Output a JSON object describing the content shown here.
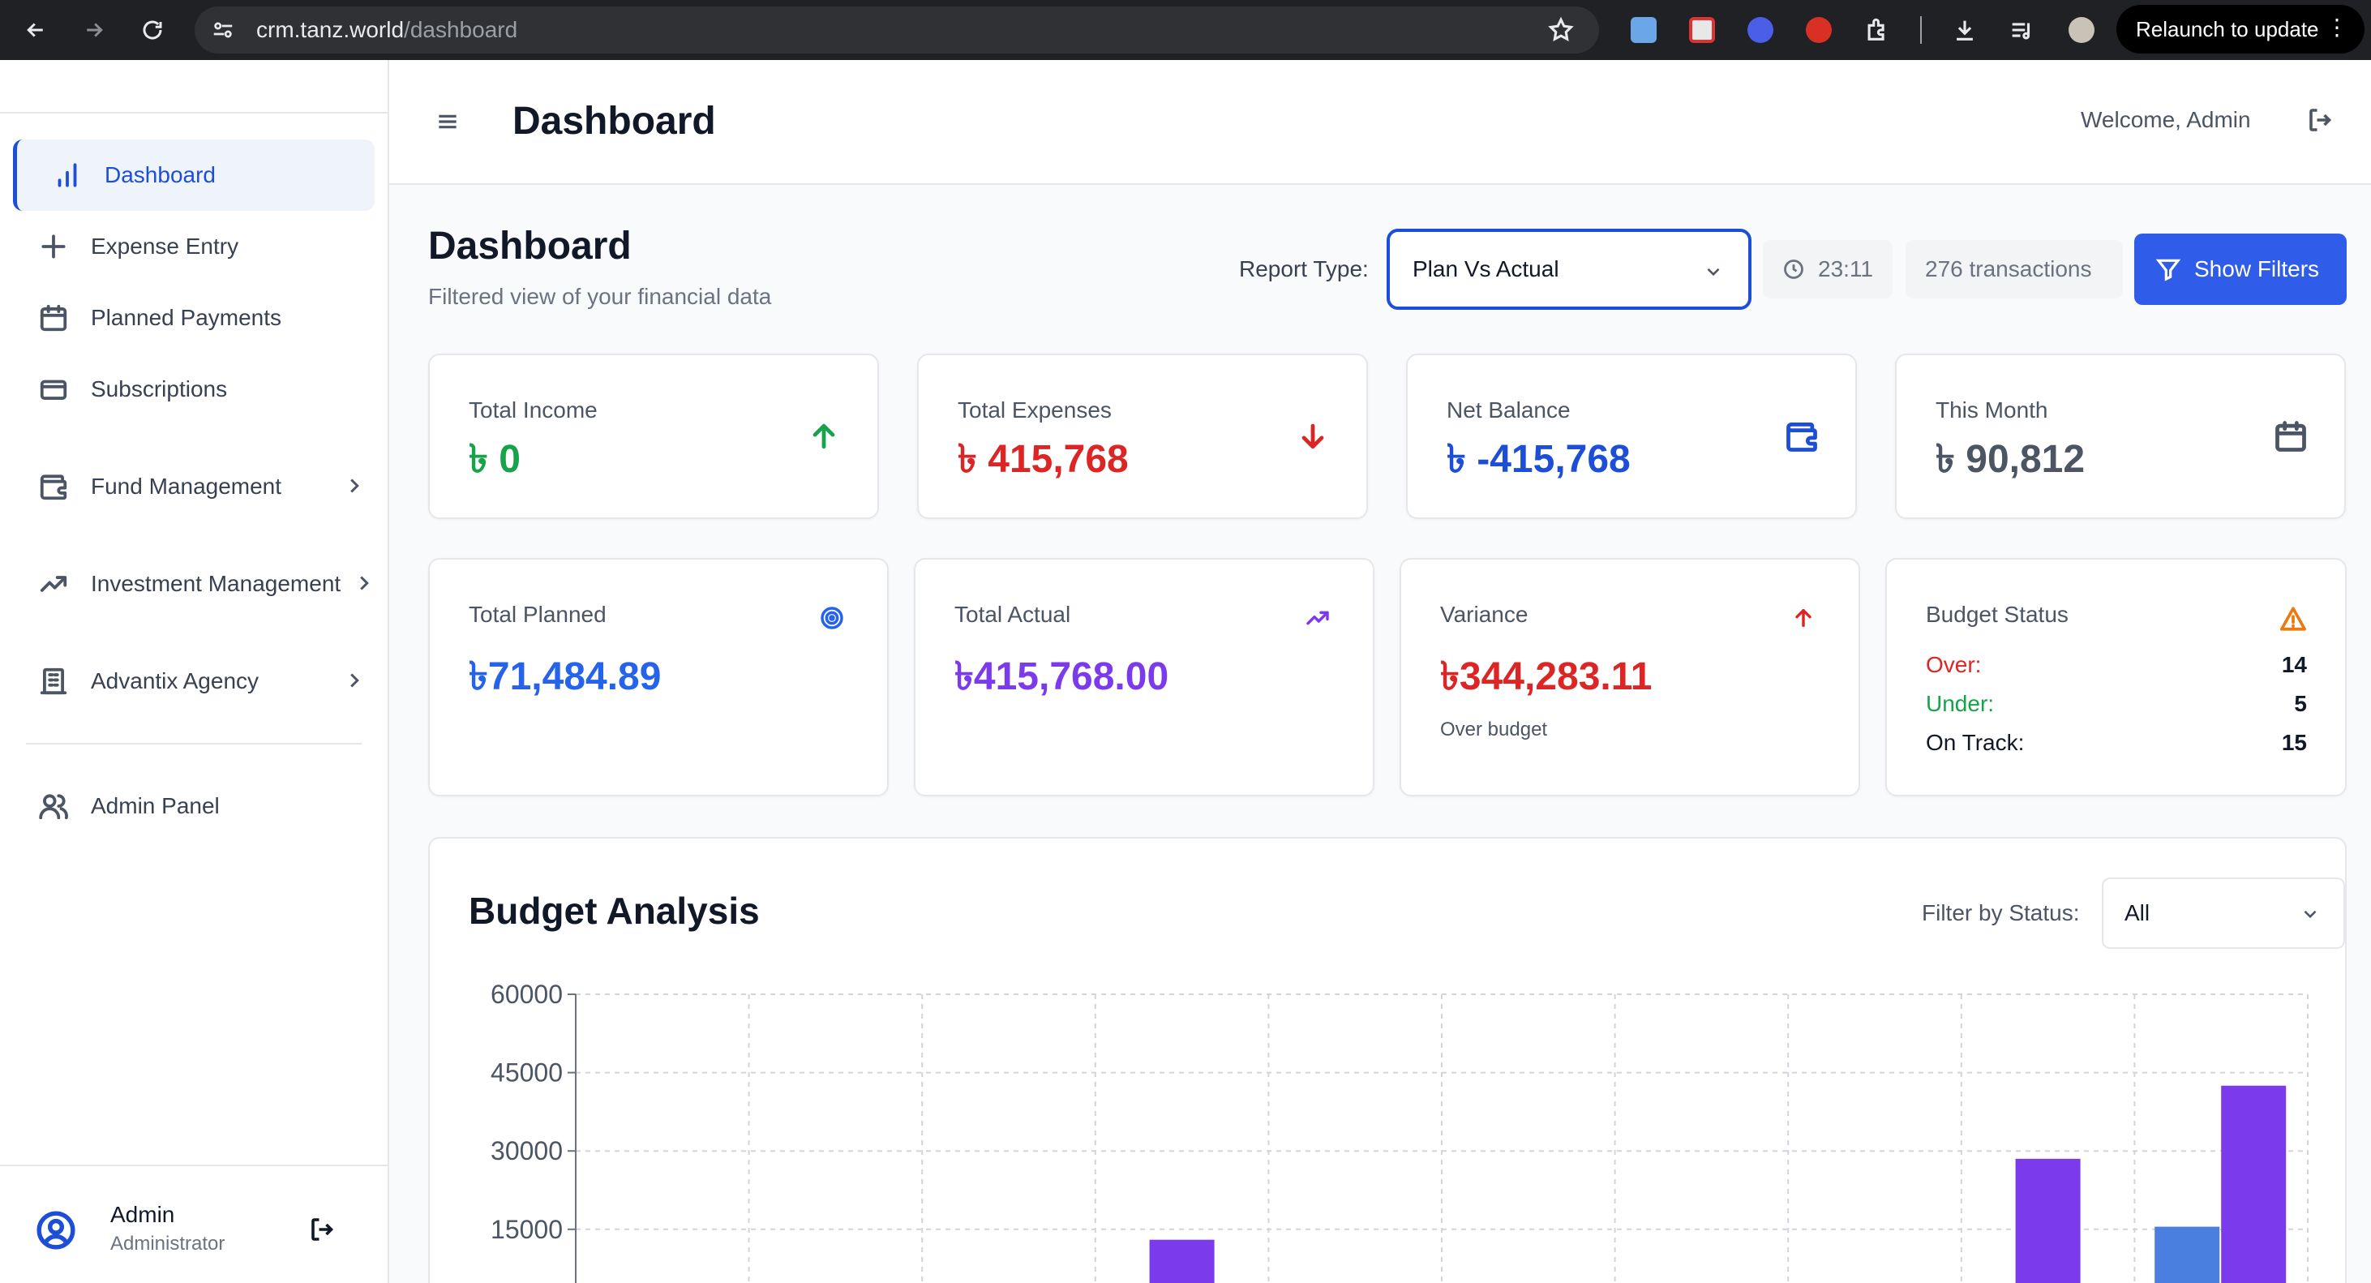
{
  "browser": {
    "url_host": "crm.tanz.world",
    "url_path": "/dashboard",
    "relaunch_label": "Relaunch to update",
    "menu_dots": "⋮"
  },
  "sidebar": {
    "items": [
      {
        "label": "Dashboard",
        "icon": "bar-chart-icon",
        "active": true
      },
      {
        "label": "Expense Entry",
        "icon": "plus-icon"
      },
      {
        "label": "Planned Payments",
        "icon": "calendar-icon"
      },
      {
        "label": "Subscriptions",
        "icon": "credit-card-icon"
      },
      {
        "label": "Fund Management",
        "icon": "wallet-icon",
        "has_submenu": true
      },
      {
        "label": "Investment Management",
        "icon": "trending-up-icon",
        "has_submenu": true
      },
      {
        "label": "Advantix Agency",
        "icon": "building-icon",
        "has_submenu": true
      },
      {
        "label": "Admin Panel",
        "icon": "users-icon"
      }
    ],
    "user": {
      "name": "Admin",
      "role": "Administrator"
    }
  },
  "header": {
    "title": "Dashboard",
    "welcome": "Welcome, Admin"
  },
  "page": {
    "title": "Dashboard",
    "subtitle": "Filtered view of your financial data",
    "report_type_label": "Report Type:",
    "report_type_value": "Plan Vs Actual",
    "time": "23:11",
    "transactions": "276 transactions",
    "show_filters": "Show Filters"
  },
  "colors": {
    "accent": "#2f5ce8",
    "income": "#16a34a",
    "expense": "#dc2626",
    "balance": "#1d4ed8",
    "month": "#4b5563",
    "planned": "#2563eb",
    "actual": "#7c3aed",
    "variance": "#dc2626"
  },
  "stats": [
    {
      "label": "Total Income",
      "value": "৳ 0",
      "icon": "arrow-up-icon"
    },
    {
      "label": "Total Expenses",
      "value": "৳ 415,768",
      "icon": "arrow-down-icon"
    },
    {
      "label": "Net Balance",
      "value": "৳ -415,768",
      "icon": "wallet-icon"
    },
    {
      "label": "This Month",
      "value": "৳ 90,812",
      "icon": "calendar-icon"
    }
  ],
  "plan_stats": [
    {
      "label": "Total Planned",
      "value": "৳71,484.89",
      "icon": "target-icon"
    },
    {
      "label": "Total Actual",
      "value": "৳415,768.00",
      "icon": "trending-up-icon"
    },
    {
      "label": "Variance",
      "value": "৳344,283.11",
      "sub": "Over budget",
      "icon": "arrow-up-icon"
    }
  ],
  "budget_status": {
    "label": "Budget Status",
    "icon": "warning-icon",
    "rows": [
      {
        "label": "Over:",
        "value": "14",
        "color": "#dc2626"
      },
      {
        "label": "Under:",
        "value": "5",
        "color": "#16a34a"
      },
      {
        "label": "On Track:",
        "value": "15",
        "color": "#111827"
      }
    ]
  },
  "budget_analysis": {
    "title": "Budget Analysis",
    "filter_label": "Filter by Status:",
    "filter_value": "All"
  },
  "chart_data": {
    "type": "bar",
    "ylim": [
      0,
      60000
    ],
    "yticks": [
      "60000",
      "45000",
      "30000",
      "15000"
    ],
    "grid": true,
    "num_categories": 10,
    "series": [
      {
        "color": "#4a7fe0",
        "values": [
          null,
          null,
          null,
          null,
          null,
          null,
          null,
          null,
          null,
          15500
        ]
      },
      {
        "color": "#7c3aed",
        "values": [
          null,
          null,
          null,
          13000,
          null,
          null,
          null,
          null,
          28500,
          42500
        ]
      }
    ]
  }
}
